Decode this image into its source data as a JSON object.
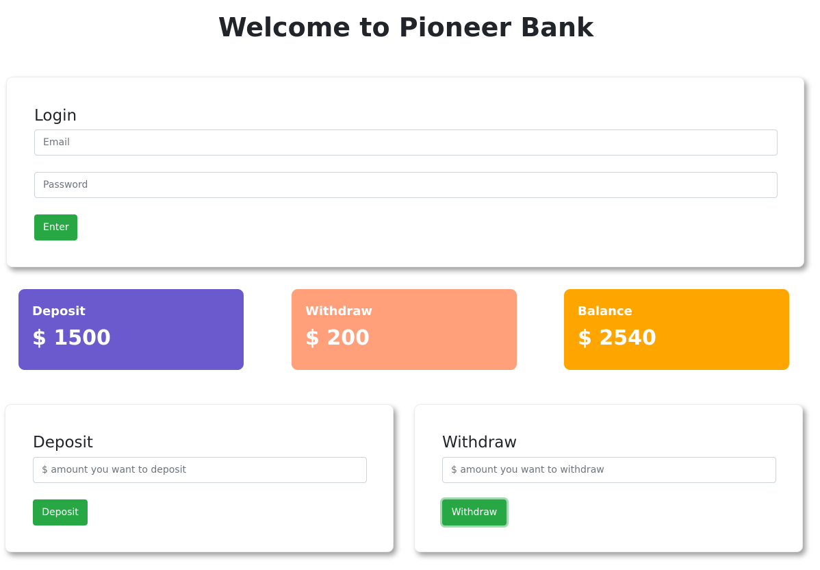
{
  "page": {
    "title": "Welcome to Pioneer Bank"
  },
  "login": {
    "heading": "Login",
    "email_placeholder": "Email",
    "email_value": "",
    "password_placeholder": "Password",
    "password_value": "",
    "submit_label": "Enter"
  },
  "stats": [
    {
      "label": "Deposit",
      "value": "$ 1500",
      "color": "#6a5acd"
    },
    {
      "label": "Withdraw",
      "value": "$ 200",
      "color": "#ffa07a"
    },
    {
      "label": "Balance",
      "value": "$ 2540",
      "color": "#ffa500"
    }
  ],
  "deposit_form": {
    "heading": "Deposit",
    "amount_placeholder": "$ amount you want to deposit",
    "amount_value": "",
    "button_label": "Deposit"
  },
  "withdraw_form": {
    "heading": "Withdraw",
    "amount_placeholder": "$ amount you want to withdraw",
    "amount_value": "",
    "button_label": "Withdraw"
  },
  "colors": {
    "button_green": "#28a745",
    "text_dark": "#212529"
  }
}
